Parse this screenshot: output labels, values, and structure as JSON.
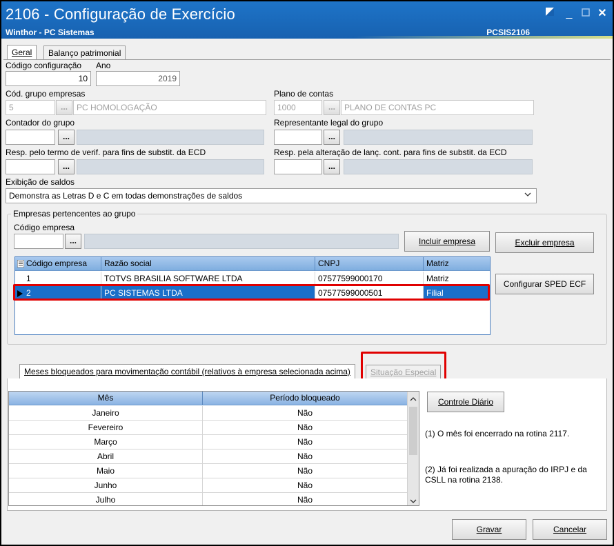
{
  "window": {
    "title": "2106 - Configuração de Exercício",
    "subtitle": "Winthor - PC Sistemas",
    "code": "PCSIS2106",
    "restore_icon": "restore-icon",
    "minimize_icon": "minimize-icon",
    "maximize_icon": "maximize-icon",
    "close_icon": "close-icon"
  },
  "main_tabs": [
    {
      "label": "Geral"
    },
    {
      "label": "Balanço patrimonial"
    }
  ],
  "fields": {
    "codigo_config": {
      "label": "Código configuração",
      "value": "10"
    },
    "ano": {
      "label": "Ano",
      "value": "2019"
    },
    "grupo_empresas": {
      "label": "Cód. grupo empresas",
      "code": "5",
      "desc": "PC HOMOLOGAÇÃO"
    },
    "plano_contas": {
      "label": "Plano de contas",
      "code": "1000",
      "desc": "PLANO DE CONTAS PC"
    },
    "contador": {
      "label": "Contador do grupo"
    },
    "representante": {
      "label": "Representante legal do grupo"
    },
    "resp_termo": {
      "label": "Resp. pelo termo de verif. para fins de substit. da ECD"
    },
    "resp_alteracao": {
      "label": "Resp. pela alteração de lanç. cont. para fins de substit. da ECD"
    },
    "exibicao": {
      "label": "Exibição de saldos",
      "value": "Demonstra as Letras D e C em todas demonstrações de saldos"
    },
    "dots": "..."
  },
  "empresas": {
    "group_title": "Empresas pertencentes ao grupo",
    "codigo_label": "Código empresa",
    "incluir": "Incluir empresa",
    "excluir": "Excluir empresa",
    "configurar": "Configurar SPED ECF",
    "columns": [
      "Código empresa",
      "Razão social",
      "CNPJ",
      "Matriz"
    ],
    "rows": [
      {
        "codigo": "1",
        "razao": "TOTVS BRASILIA SOFTWARE LTDA",
        "cnpj": "07577599000170",
        "matriz": "Matriz"
      },
      {
        "codigo": "2",
        "razao": "PC SISTEMAS LTDA",
        "cnpj": "07577599000501",
        "matriz": "Filial"
      }
    ]
  },
  "meses_tabs": [
    {
      "label": "Meses bloqueados para movimentação contábil (relativos à empresa selecionada acima)"
    },
    {
      "label": "Situação Especial"
    }
  ],
  "meses": {
    "columns": [
      "Mês",
      "Período bloqueado"
    ],
    "rows": [
      {
        "mes": "Janeiro",
        "bloq": "Não"
      },
      {
        "mes": "Fevereiro",
        "bloq": "Não"
      },
      {
        "mes": "Março",
        "bloq": "Não"
      },
      {
        "mes": "Abril",
        "bloq": "Não"
      },
      {
        "mes": "Maio",
        "bloq": "Não"
      },
      {
        "mes": "Junho",
        "bloq": "Não"
      },
      {
        "mes": "Julho",
        "bloq": "Não"
      }
    ],
    "controle": "Controle Diário",
    "note1": "(1)  O mês foi encerrado na rotina 2117.",
    "note2": "(2)  Já foi realizada a apuração do IRPJ e da CSLL na rotina 2138."
  },
  "footer": {
    "gravar": "Gravar",
    "cancelar": "Cancelar"
  },
  "colors": {
    "title_bar": "#1761b0",
    "highlight_red": "#e00000",
    "selection": "#1a6fc9"
  }
}
